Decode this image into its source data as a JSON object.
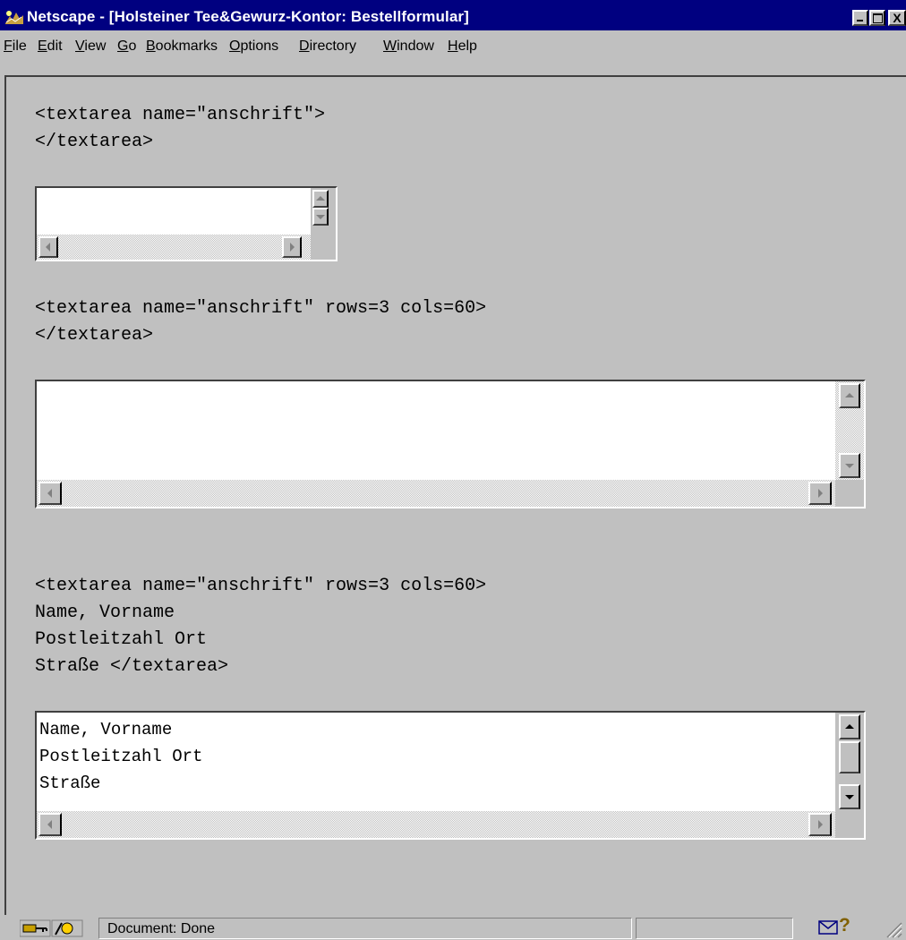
{
  "window": {
    "title": "Netscape - [Holsteiner Tee&Gewurz-Kontor: Bestellformular]",
    "title_bar_color": "#000080",
    "controls": {
      "minimize_icon": "minimize-icon",
      "maximize_icon": "maximize-icon",
      "close_label": "X"
    }
  },
  "menu": {
    "items": [
      "File",
      "Edit",
      "View",
      "Go",
      "Bookmarks",
      "Options",
      "Directory",
      "Window",
      "Help"
    ]
  },
  "examples": [
    {
      "code": "<textarea name=\"anschrift\">\n</textarea>",
      "textarea_value": ""
    },
    {
      "code": "<textarea name=\"anschrift\" rows=3 cols=60>\n</textarea>",
      "textarea_value": ""
    },
    {
      "code": "<textarea name=\"anschrift\" rows=3 cols=60>\nName, Vorname\nPostleitzahl Ort\nStraße </textarea>",
      "textarea_value": "Name, Vorname\nPostleitzahl Ort\nStraße"
    }
  ],
  "status": {
    "text": "Document: Done",
    "icons": [
      "security-key-icon",
      "component-bar-icon",
      "mail-icon",
      "help-icon"
    ],
    "help_glyph": "?"
  }
}
